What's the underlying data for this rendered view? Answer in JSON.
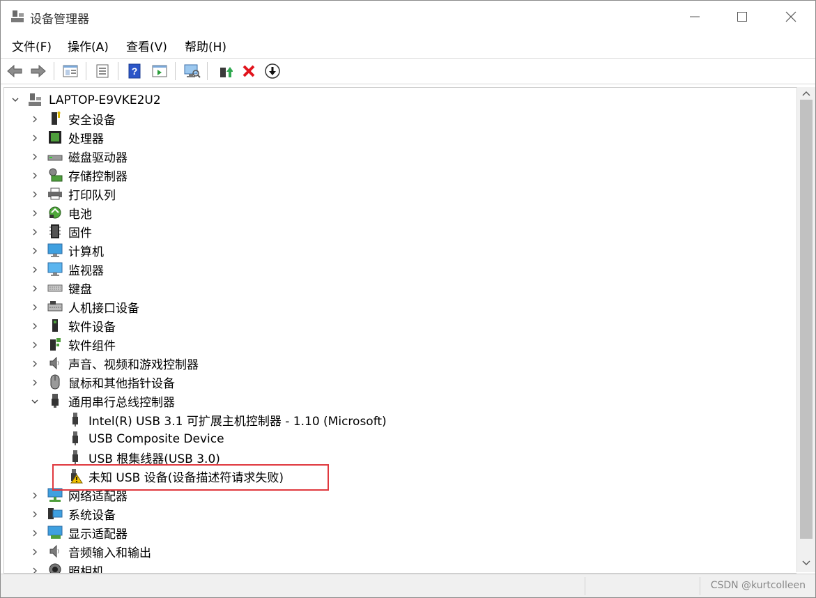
{
  "window": {
    "title": "设备管理器"
  },
  "menu": [
    "文件(F)",
    "操作(A)",
    "查看(V)",
    "帮助(H)"
  ],
  "toolbar": {
    "buttons": [
      "back-icon",
      "forward-icon",
      "show-hide-tree-icon",
      "properties-icon",
      "help-icon",
      "action-pane-icon",
      "scan-hardware-icon",
      "update-driver-icon",
      "uninstall-icon",
      "disable-device-icon"
    ]
  },
  "tree": {
    "root": "LAPTOP-E9VKE2U2",
    "categories": [
      {
        "label": "安全设备",
        "icon": "security-device-icon",
        "expanded": false
      },
      {
        "label": "处理器",
        "icon": "processor-icon",
        "expanded": false
      },
      {
        "label": "磁盘驱动器",
        "icon": "disk-drive-icon",
        "expanded": false
      },
      {
        "label": "存储控制器",
        "icon": "storage-controller-icon",
        "expanded": false
      },
      {
        "label": "打印队列",
        "icon": "printer-icon",
        "expanded": false
      },
      {
        "label": "电池",
        "icon": "battery-icon",
        "expanded": false
      },
      {
        "label": "固件",
        "icon": "firmware-icon",
        "expanded": false
      },
      {
        "label": "计算机",
        "icon": "computer-icon",
        "expanded": false
      },
      {
        "label": "监视器",
        "icon": "monitor-icon",
        "expanded": false
      },
      {
        "label": "键盘",
        "icon": "keyboard-icon",
        "expanded": false
      },
      {
        "label": "人机接口设备",
        "icon": "hid-icon",
        "expanded": false
      },
      {
        "label": "软件设备",
        "icon": "software-device-icon",
        "expanded": false
      },
      {
        "label": "软件组件",
        "icon": "software-component-icon",
        "expanded": false
      },
      {
        "label": "声音、视频和游戏控制器",
        "icon": "sound-icon",
        "expanded": false
      },
      {
        "label": "鼠标和其他指针设备",
        "icon": "mouse-icon",
        "expanded": false
      },
      {
        "label": "通用串行总线控制器",
        "icon": "usb-icon",
        "expanded": true,
        "children": [
          {
            "label": "Intel(R) USB 3.1 可扩展主机控制器 - 1.10 (Microsoft)",
            "icon": "usb-icon",
            "warning": false
          },
          {
            "label": "USB Composite Device",
            "icon": "usb-icon",
            "warning": false
          },
          {
            "label": "USB 根集线器(USB 3.0)",
            "icon": "usb-icon",
            "warning": false
          },
          {
            "label": "未知 USB 设备(设备描述符请求失败)",
            "icon": "usb-warning-icon",
            "warning": true
          }
        ]
      },
      {
        "label": "网络适配器",
        "icon": "network-adapter-icon",
        "expanded": false
      },
      {
        "label": "系统设备",
        "icon": "system-device-icon",
        "expanded": false
      },
      {
        "label": "显示适配器",
        "icon": "display-adapter-icon",
        "expanded": false
      },
      {
        "label": "音频输入和输出",
        "icon": "audio-io-icon",
        "expanded": false
      },
      {
        "label": "照相机",
        "icon": "camera-icon",
        "expanded": false
      }
    ]
  },
  "status": {
    "watermark": "CSDN @kurtcolleen"
  },
  "colors": {
    "highlight": "#e0383e",
    "warning": "#f2c200",
    "usb": "#555555"
  }
}
